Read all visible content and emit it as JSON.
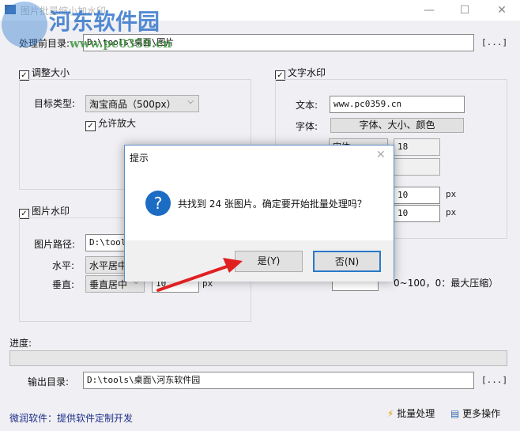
{
  "window": {
    "title": "图片批量缩小加水印",
    "minimize": "—",
    "maximize": "☐",
    "close": "✕"
  },
  "watermark": {
    "name": "河东软件园",
    "url": "www.pc0359.cn"
  },
  "source_dir": {
    "label": "处理前目录:",
    "value": "D:\\tools\\桌面\\图片",
    "browse": "[...]"
  },
  "resize": {
    "label": "调整大小",
    "checked": true,
    "target_type_label": "目标类型:",
    "target_type": "淘宝商品（500px）",
    "allow_enlarge": "允许放大"
  },
  "text_watermark": {
    "label": "文字水印",
    "text_label": "文本:",
    "text_value": "www.pc0359.cn",
    "font_label": "字体:",
    "font_button": "字体、大小、颜色",
    "font_name": "宋体",
    "font_size": "18",
    "offset_x": "10",
    "offset_y": "10",
    "unit": "px"
  },
  "image_watermark": {
    "label": "图片水印",
    "path_label": "图片路径:",
    "path_value": "D:\\tools",
    "h_label": "水平:",
    "h_value": "水平居中",
    "v_label": "垂直:",
    "v_value": "垂直居中",
    "offset": "10",
    "unit": "px"
  },
  "compression": {
    "hint": "0~100，0：最大压缩）"
  },
  "progress": {
    "label": "进度:",
    "value": 0
  },
  "output_dir": {
    "label": "输出目录:",
    "value": "D:\\tools\\桌面\\河东软件园",
    "browse": "[...]"
  },
  "footer": {
    "link": "微润软件：提供软件定制开发",
    "batch": "批量处理",
    "more": "更多操作"
  },
  "dialog": {
    "title": "提示",
    "message": "共找到 24 张图片。确定要开始批量处理吗？",
    "yes": "是(Y)",
    "no": "否(N)",
    "close": "✕"
  }
}
